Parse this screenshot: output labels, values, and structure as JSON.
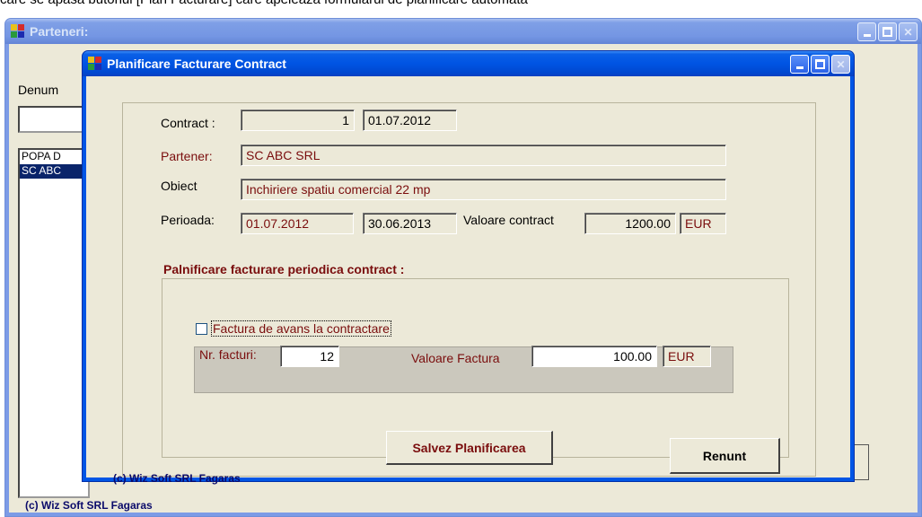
{
  "page": {
    "caption": "care se apasa butonul [Plan Facturare] care apeleaza formularul de planificare automata"
  },
  "background_window": {
    "title": "Parteneri:",
    "denumire_label": "Denum",
    "list_items": [
      "POPA D",
      "SC ABC"
    ],
    "footer": "(c) Wiz Soft SRL Fagaras"
  },
  "dialog": {
    "title": "Planificare Facturare Contract",
    "contract_label": "Contract :",
    "contract_number": "1",
    "contract_date": "01.07.2012",
    "partener_label": "Partener:",
    "partener_value": "SC ABC SRL",
    "obiect_label": "Obiect",
    "obiect_value": "Inchiriere spatiu comercial 22 mp",
    "perioada_label": "Perioada:",
    "perioada_start": "01.07.2012",
    "perioada_end": "30.06.2013",
    "valoare_contract_label": "Valoare contract",
    "valoare_contract_value": "1200.00",
    "valoare_contract_currency": "EUR",
    "planning_group_label": "Palnificare facturare periodica contract :",
    "avans_checkbox_label": "Factura de avans la contractare",
    "avans_checked": false,
    "nr_facturi_label": "Nr. facturi:",
    "nr_facturi_value": "12",
    "valoare_factura_label": "Valoare Factura",
    "valoare_factura_value": "100.00",
    "valoare_factura_currency": "EUR",
    "save_button": "Salvez Planificarea",
    "cancel_button": "Renunt",
    "footer": "(c) Wiz Soft SRL Fagaras"
  }
}
